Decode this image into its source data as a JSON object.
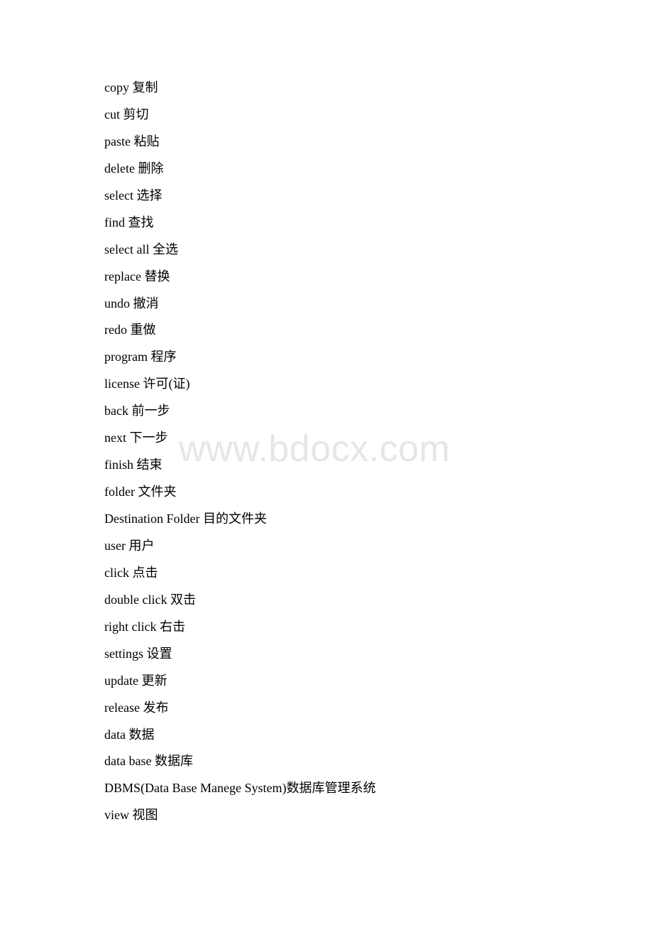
{
  "document": {
    "entries": [
      {
        "en": "copy",
        "zh": "复制"
      },
      {
        "en": "cut",
        "zh": "剪切"
      },
      {
        "en": "paste",
        "zh": "粘贴"
      },
      {
        "en": "delete",
        "zh": "删除"
      },
      {
        "en": "select",
        "zh": "选择"
      },
      {
        "en": "find",
        "zh": "查找"
      },
      {
        "en": "select all",
        "zh": "全选"
      },
      {
        "en": "replace",
        "zh": "替换"
      },
      {
        "en": "undo",
        "zh": "撤消"
      },
      {
        "en": "redo",
        "zh": "重做"
      },
      {
        "en": "program",
        "zh": "程序"
      },
      {
        "en": "license",
        "zh": "许可(证)"
      },
      {
        "en": "back",
        "zh": "前一步"
      },
      {
        "en": "next",
        "zh": "下一步"
      },
      {
        "en": "finish",
        "zh": "结束"
      },
      {
        "en": "folder",
        "zh": "文件夹"
      },
      {
        "en": "Destination Folder",
        "zh": "目的文件夹"
      },
      {
        "en": "user",
        "zh": "用户"
      },
      {
        "en": "click",
        "zh": "点击"
      },
      {
        "en": "double click",
        "zh": "双击"
      },
      {
        "en": "right click",
        "zh": "右击"
      },
      {
        "en": "settings",
        "zh": "设置"
      },
      {
        "en": "update",
        "zh": "更新"
      },
      {
        "en": "release",
        "zh": "发布"
      },
      {
        "en": "data",
        "zh": "数据"
      },
      {
        "en": "data base",
        "zh": "数据库"
      },
      {
        "en": "DBMS(Data Base Manege System)",
        "zh": "数据库管理系统",
        "no_space": true
      },
      {
        "en": "view",
        "zh": "视图"
      }
    ]
  },
  "watermark": {
    "text": "www.bdocx.com",
    "color": "#e6e6e6"
  }
}
